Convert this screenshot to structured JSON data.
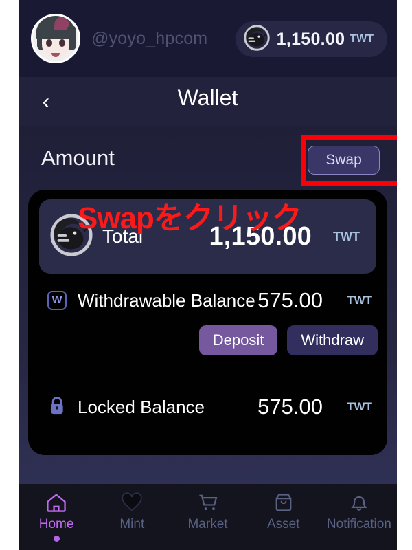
{
  "account": {
    "username": "@yoyo_hpcom",
    "avatar_icon": "user-avatar-anime",
    "balance_amount": "1,150.00",
    "balance_unit": "TWT",
    "coin_icon": "twt-coin-icon"
  },
  "header": {
    "back_icon": "chevron-left-icon",
    "title": "Wallet"
  },
  "section": {
    "amount_label": "Amount",
    "swap_label": "Swap"
  },
  "annotation": {
    "text": "Swapをクリック",
    "color": "#fb0007"
  },
  "card": {
    "total": {
      "icon": "twt-coin-icon",
      "label": "Total",
      "value": "1,150.00",
      "unit": "TWT"
    },
    "withdrawable": {
      "icon": "withdrawable-w-icon",
      "icon_letter": "W",
      "label": "Withdrawable Balance",
      "value": "575.00",
      "unit": "TWT"
    },
    "actions": {
      "deposit_label": "Deposit",
      "withdraw_label": "Withdraw",
      "deposit_color": "#76589e",
      "withdraw_color": "#322f5e"
    },
    "locked": {
      "icon": "lock-icon",
      "label": "Locked Balance",
      "value": "575.00",
      "unit": "TWT"
    }
  },
  "bottom_nav": {
    "items": [
      {
        "label": "Home",
        "icon": "home-icon",
        "active": true
      },
      {
        "label": "Mint",
        "icon": "heart-icon",
        "active": false
      },
      {
        "label": "Market",
        "icon": "shopping-cart-icon",
        "active": false
      },
      {
        "label": "Asset",
        "icon": "box-icon",
        "active": false
      },
      {
        "label": "Notification",
        "icon": "bell-icon",
        "active": false
      }
    ],
    "active_color": "#c06af0",
    "inactive_color": "#5a6283"
  }
}
